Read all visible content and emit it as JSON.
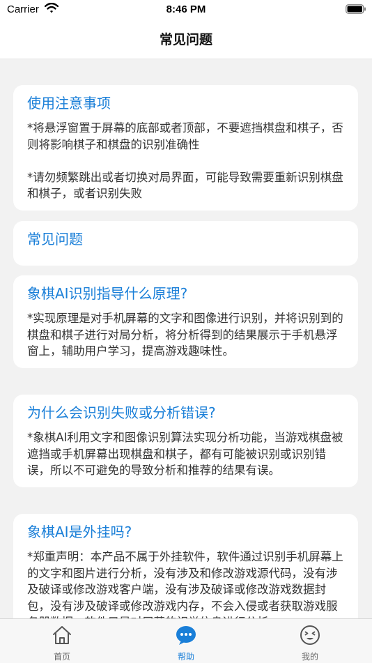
{
  "status_bar": {
    "carrier": "Carrier",
    "time": "8:46 PM"
  },
  "nav": {
    "title": "常见问题"
  },
  "cards": [
    {
      "title": "使用注意事项",
      "paragraphs": [
        "*将悬浮窗置于屏幕的底部或者顶部，不要遮挡棋盘和棋子，否则将影响棋子和棋盘的识别准确性",
        "*请勿频繁跳出或者切换对局界面，可能导致需要重新识别棋盘和棋子，或者识别失败"
      ]
    },
    {
      "title": "常见问题",
      "paragraphs": []
    },
    {
      "title": "象棋AI识别指导什么原理?",
      "paragraphs": [
        "*实现原理是对手机屏幕的文字和图像进行识别，并将识别到的棋盘和棋子进行对局分析，将分析得到的结果展示于手机悬浮窗上，辅助用户学习，提高游戏趣味性。"
      ]
    },
    {
      "title": "为什么会识别失败或分析错误?",
      "paragraphs": [
        "*象棋AI利用文字和图像识别算法实现分析功能，当游戏棋盘被遮挡或手机屏幕出现棋盘和棋子，都有可能被识别或识别错误，所以不可避免的导致分析和推荐的结果有误。"
      ]
    },
    {
      "title": "象棋AI是外挂吗?",
      "paragraphs": [
        "*郑重声明：本产品不属于外挂软件，软件通过识别手机屏幕上的文字和图片进行分析，没有涉及和修改游戏源代码，没有涉及破译或修改游戏客户端，没有涉及破译或修改游戏数据封包，没有涉及破译或修改游戏内存，不会入侵或者获取游戏服务器数据，软件只是对屏幕的视觉信息进行分析。"
      ]
    }
  ],
  "tabs": [
    {
      "label": "首页",
      "icon": "home-icon",
      "active": false
    },
    {
      "label": "帮助",
      "icon": "chat-bubble-icon",
      "active": true
    },
    {
      "label": "我的",
      "icon": "face-icon",
      "active": false
    }
  ],
  "colors": {
    "accent": "#1a7fd8",
    "background": "#f2f2f2",
    "card": "#ffffff"
  }
}
